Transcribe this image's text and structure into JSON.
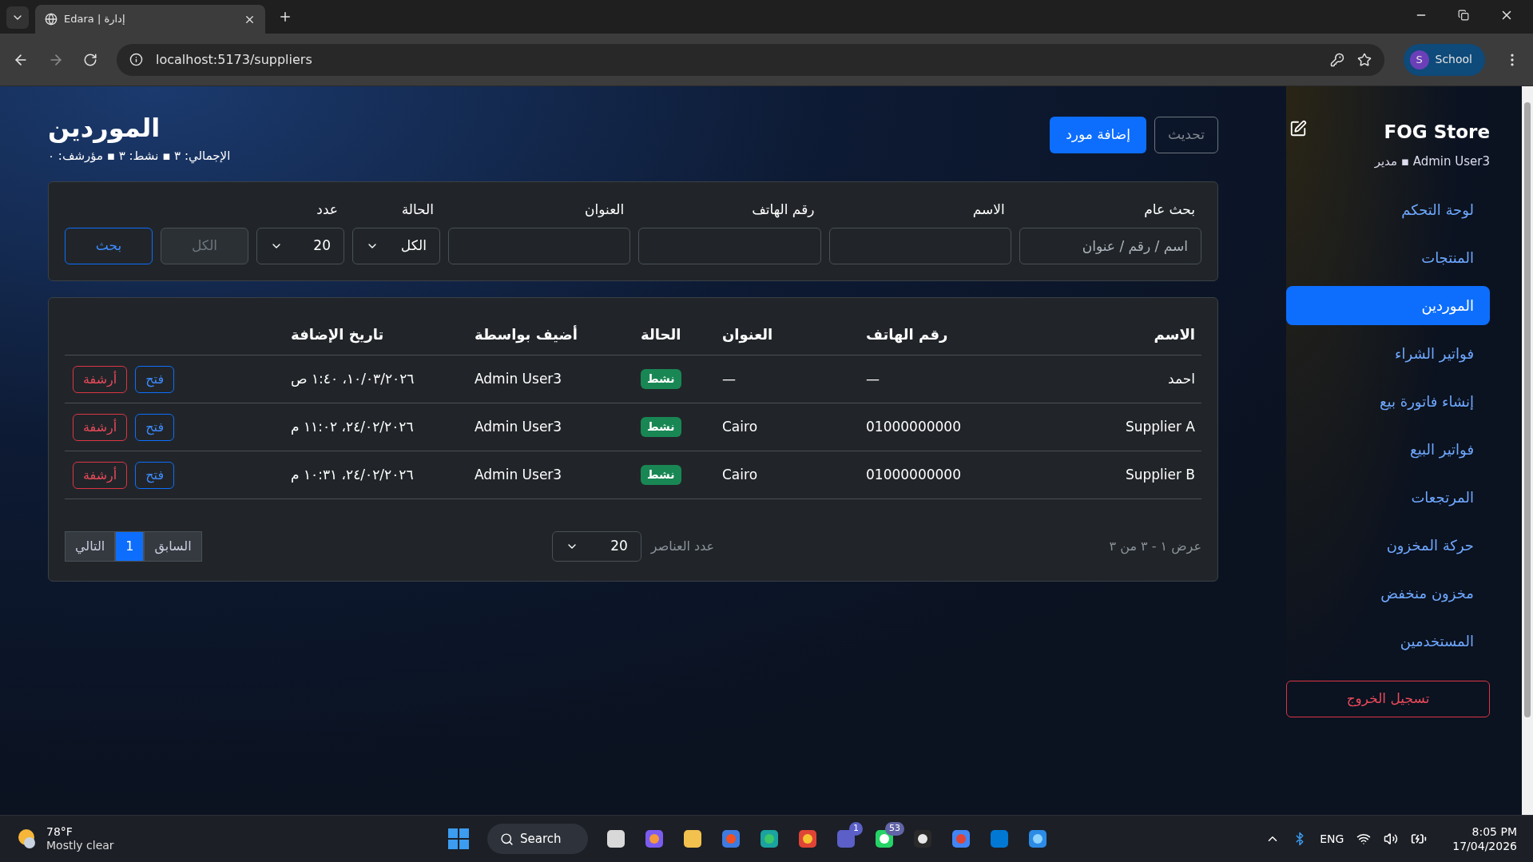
{
  "browser": {
    "tab_title": "Edara | إدارة",
    "url": "localhost:5173/suppliers",
    "profile_initial": "S",
    "profile_name": "School"
  },
  "sidebar": {
    "store_name": "FOG Store",
    "user_line": "Admin User3 ▪ مدير",
    "items": [
      {
        "label": "لوحة التحكم",
        "selected": false
      },
      {
        "label": "المنتجات",
        "selected": false
      },
      {
        "label": "الموردين",
        "selected": true
      },
      {
        "label": "فواتير الشراء",
        "selected": false
      },
      {
        "label": "إنشاء فاتورة بيع",
        "selected": false
      },
      {
        "label": "فواتير البيع",
        "selected": false
      },
      {
        "label": "المرتجعات",
        "selected": false
      },
      {
        "label": "حركة المخزون",
        "selected": false
      },
      {
        "label": "مخزون منخفض",
        "selected": false
      },
      {
        "label": "المستخدمين",
        "selected": false
      }
    ],
    "logout": "تسجيل الخروج"
  },
  "header": {
    "title": "الموردين",
    "summary": "الإجمالي: ٣ ▪ نشط: ٣ ▪ مؤرشف: ٠",
    "add_button": "إضافة مورد",
    "refresh_button": "تحديث"
  },
  "filters": {
    "fields": [
      {
        "kind": "text",
        "label": "بحث عام",
        "placeholder": "اسم / رقم / عنوان"
      },
      {
        "kind": "text",
        "label": "الاسم"
      },
      {
        "kind": "text",
        "label": "رقم الهاتف"
      },
      {
        "kind": "text",
        "label": "العنوان"
      },
      {
        "kind": "select",
        "label": "الحالة",
        "value": "الكل"
      },
      {
        "kind": "select",
        "label": "عدد",
        "value": "20"
      }
    ],
    "reset_button": "الكل",
    "search_button": "بحث"
  },
  "table": {
    "columns": [
      "الاسم",
      "رقم الهاتف",
      "العنوان",
      "الحالة",
      "أضيف بواسطة",
      "تاريخ الإضافة"
    ],
    "rows": [
      {
        "name": "احمد",
        "phone": "—",
        "address": "—",
        "status": "نشط",
        "added_by": "Admin User3",
        "date": "١٠/٠٣/٢٠٢٦، ١:٤٠ ص",
        "open": "فتح",
        "archive": "أرشفة"
      },
      {
        "name": "Supplier A",
        "phone": "01000000000",
        "address": "Cairo",
        "status": "نشط",
        "added_by": "Admin User3",
        "date": "٢٤/٠٢/٢٠٢٦، ١١:٠٢ م",
        "open": "فتح",
        "archive": "أرشفة"
      },
      {
        "name": "Supplier B",
        "phone": "01000000000",
        "address": "Cairo",
        "status": "نشط",
        "added_by": "Admin User3",
        "date": "٢٤/٠٢/٢٠٢٦، ١٠:٣١ م",
        "open": "فتح",
        "archive": "أرشفة"
      }
    ]
  },
  "pagination": {
    "range": "عرض ١ - ٣ من ٣",
    "per_page_label": "عدد العناصر",
    "per_page": "20",
    "pages": [
      {
        "label": "السابق",
        "selected": false
      },
      {
        "label": "1",
        "selected": true
      },
      {
        "label": "التالي",
        "selected": false
      }
    ]
  },
  "taskbar": {
    "temperature": "78°F",
    "weather": "Mostly clear",
    "search": "Search",
    "teams_badge": "1",
    "whatsapp_badge": "53",
    "language": "ENG",
    "time": "8:05 PM",
    "date": "17/04/2026"
  }
}
